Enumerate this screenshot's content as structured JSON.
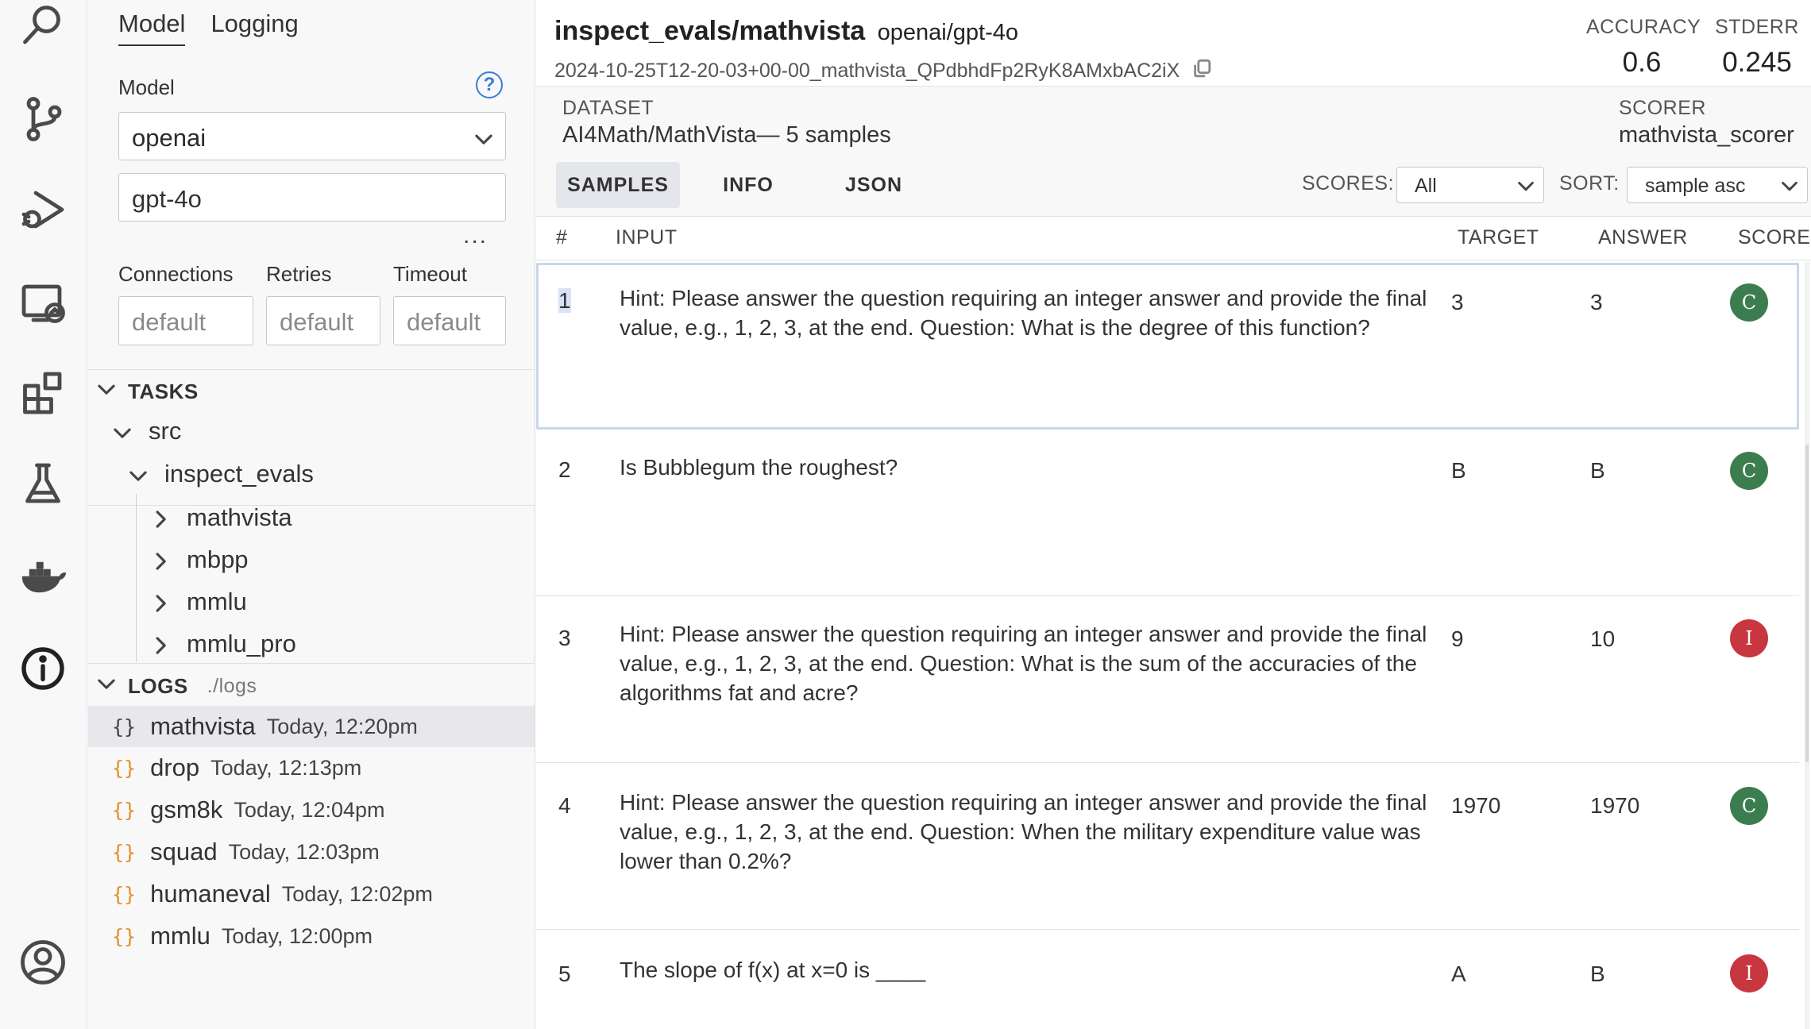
{
  "activity_bar": {
    "icons": [
      "search-icon",
      "source-control-icon",
      "run-debug-icon",
      "remote-explorer-icon",
      "extensions-icon",
      "testing-icon",
      "docker-icon",
      "info-icon",
      "account-icon"
    ]
  },
  "side_panel": {
    "tabs": [
      "Model",
      "Logging"
    ],
    "active_tab": "Model",
    "model_label": "Model",
    "provider_value": "openai",
    "model_value": "gpt-4o",
    "more_label": "...",
    "connections_label": "Connections",
    "retries_label": "Retries",
    "timeout_label": "Timeout",
    "connections_placeholder": "default",
    "retries_placeholder": "default",
    "timeout_placeholder": "default",
    "tasks_header": "TASKS",
    "tasks_tree": {
      "root": "src",
      "folder": "inspect_evals",
      "items": [
        "mathvista",
        "mbpp",
        "mmlu",
        "mmlu_pro"
      ]
    },
    "logs_header": "LOGS",
    "logs_path": "./logs",
    "logs": [
      {
        "name": "mathvista",
        "time": "Today, 12:20pm"
      },
      {
        "name": "drop",
        "time": "Today, 12:13pm"
      },
      {
        "name": "gsm8k",
        "time": "Today, 12:04pm"
      },
      {
        "name": "squad",
        "time": "Today, 12:03pm"
      },
      {
        "name": "humaneval",
        "time": "Today, 12:02pm"
      },
      {
        "name": "mmlu",
        "time": "Today, 12:00pm"
      }
    ],
    "braces_glyph": "{}"
  },
  "main": {
    "title": "inspect_evals/mathvista",
    "model": "openai/gpt-4o",
    "log_id": "2024-10-25T12-20-03+00-00_mathvista_QPdbhdFp2RyK8AMxbAC2iX",
    "metrics": [
      {
        "label": "ACCURACY",
        "value": "0.6"
      },
      {
        "label": "STDERR",
        "value": "0.245"
      }
    ],
    "dataset_label": "DATASET",
    "dataset_value": "AI4Math/MathVista— 5 samples",
    "scorer_label": "SCORER",
    "scorer_value": "mathvista_scorer",
    "tabs": [
      "SAMPLES",
      "INFO",
      "JSON"
    ],
    "active_tab": "SAMPLES",
    "scores_label": "SCORES:",
    "scores_value": "All",
    "sort_label": "SORT:",
    "sort_value": "sample asc",
    "columns": [
      "#",
      "INPUT",
      "TARGET",
      "ANSWER",
      "SCORE"
    ],
    "rows": [
      {
        "num": "1",
        "input": "Hint: Please answer the question requiring an integer answer and provide the final value, e.g., 1, 2, 3, at the end. Question: What is the degree of this function?",
        "target": "3",
        "answer": "3",
        "score": "C"
      },
      {
        "num": "2",
        "input": "Is Bubblegum the roughest?",
        "target": "B",
        "answer": "B",
        "score": "C"
      },
      {
        "num": "3",
        "input": "Hint: Please answer the question requiring an integer answer and provide the final value, e.g., 1, 2, 3, at the end. Question: What is the sum of the accuracies of the algorithms fat and acre?",
        "target": "9",
        "answer": "10",
        "score": "I"
      },
      {
        "num": "4",
        "input": "Hint: Please answer the question requiring an integer answer and provide the final value, e.g., 1, 2, 3, at the end. Question: When the military expenditure value was lower than 0.2%?",
        "target": "1970",
        "answer": "1970",
        "score": "C"
      },
      {
        "num": "5",
        "input": "The slope of f(x) at x=0 is ____",
        "target": "A",
        "answer": "B",
        "score": "I"
      }
    ],
    "score_colors": {
      "C": "#3b7d4f",
      "I": "#c8363f"
    }
  }
}
